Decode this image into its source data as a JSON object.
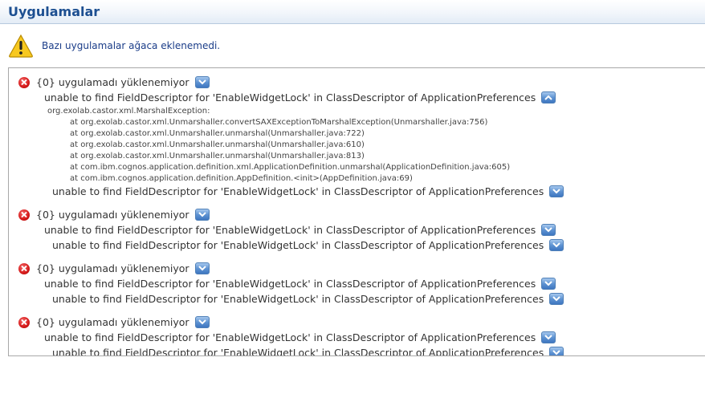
{
  "header": {
    "title": "Uygulamalar"
  },
  "warning": {
    "icon": "warning-icon",
    "text": "Bazı uygulamalar ağaca eklenemedi."
  },
  "colors": {
    "title": "#1d4f91",
    "warning_text": "#1a3c88",
    "error_icon": "#d51919",
    "toggle": "#3e76c0"
  },
  "errors": [
    {
      "heading": "{0} uygulamadı yüklenemiyor",
      "message": "unable to find FieldDescriptor for 'EnableWidgetLock' in ClassDescriptor of ApplicationPreferences",
      "trace": [
        "org.exolab.castor.xml.MarshalException:",
        "at org.exolab.castor.xml.Unmarshaller.convertSAXExceptionToMarshalException(Unmarshaller.java:756)",
        "at org.exolab.castor.xml.Unmarshaller.unmarshal(Unmarshaller.java:722)",
        "at org.exolab.castor.xml.Unmarshaller.unmarshal(Unmarshaller.java:610)",
        "at org.exolab.castor.xml.Unmarshaller.unmarshal(Unmarshaller.java:813)",
        "at com.ibm.cognos.application.definition.xml.ApplicationDefinition.unmarshal(ApplicationDefinition.java:605)",
        "at com.ibm.cognos.application.definition.AppDefinition.<init>(AppDefinition.java:69)"
      ],
      "sub_message": "unable to find FieldDescriptor for 'EnableWidgetLock' in ClassDescriptor of ApplicationPreferences"
    },
    {
      "heading": "{0} uygulamadı yüklenemiyor",
      "message": "unable to find FieldDescriptor for 'EnableWidgetLock' in ClassDescriptor of ApplicationPreferences",
      "sub_message": "unable to find FieldDescriptor for 'EnableWidgetLock' in ClassDescriptor of ApplicationPreferences"
    },
    {
      "heading": "{0} uygulamadı yüklenemiyor",
      "message": "unable to find FieldDescriptor for 'EnableWidgetLock' in ClassDescriptor of ApplicationPreferences",
      "sub_message": "unable to find FieldDescriptor for 'EnableWidgetLock' in ClassDescriptor of ApplicationPreferences"
    },
    {
      "heading": "{0} uygulamadı yüklenemiyor",
      "message": "unable to find FieldDescriptor for 'EnableWidgetLock' in ClassDescriptor of ApplicationPreferences",
      "sub_message": "unable to find FieldDescriptor for 'EnableWidgetLock' in ClassDescriptor of ApplicationPreferences"
    }
  ]
}
